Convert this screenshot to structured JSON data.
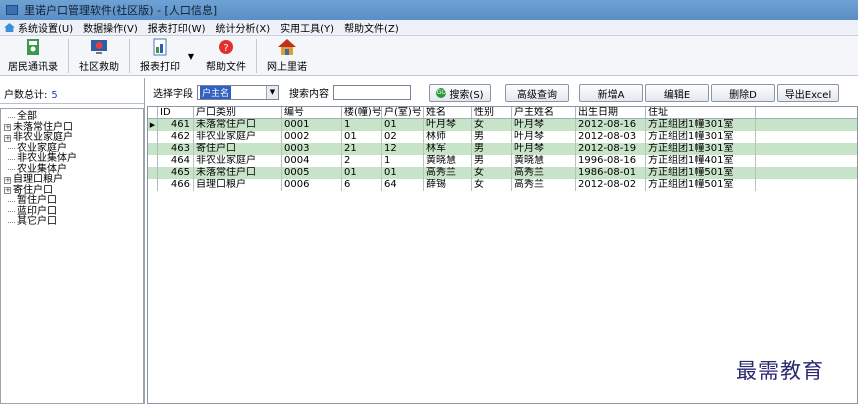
{
  "window": {
    "title": "里诺户口管理软件(社区版) - [人口信息]"
  },
  "menu": [
    "系统设置(U)",
    "数据操作(V)",
    "报表打印(W)",
    "统计分析(X)",
    "实用工具(Y)",
    "帮助文件(Z)"
  ],
  "toolbar": {
    "resident": "居民通讯录",
    "relief": "社区救助",
    "report": "报表打印",
    "help": "帮助文件",
    "online": "网上里诺"
  },
  "left": {
    "count_label": "户数总计:",
    "count_value": "5",
    "tree": [
      {
        "label": "全部",
        "type": "leaf"
      },
      {
        "label": "未落常住户口",
        "type": "plus"
      },
      {
        "label": "非农业家庭户",
        "type": "plus"
      },
      {
        "label": "农业家庭户",
        "type": "leaf"
      },
      {
        "label": "非农业集体户",
        "type": "leaf"
      },
      {
        "label": "农业集体户",
        "type": "leaf"
      },
      {
        "label": "自理口粮户",
        "type": "plus"
      },
      {
        "label": "寄住户口",
        "type": "plus"
      },
      {
        "label": "暂住户口",
        "type": "leaf"
      },
      {
        "label": "蓝印户口",
        "type": "leaf"
      },
      {
        "label": "其它户口",
        "type": "leaf"
      }
    ]
  },
  "filter": {
    "field_label": "选择字段",
    "field_value": "户主名",
    "content_label": "搜索内容",
    "content_value": "",
    "search": "搜索(S)",
    "advanced": "高级查询",
    "add": "新增A",
    "edit": "编辑E",
    "delete": "删除D",
    "export": "导出Excel"
  },
  "table": {
    "columns": [
      "ID",
      "户口类别",
      "编号",
      "楼(幢)号",
      "户(室)号",
      "姓名",
      "性别",
      "户主姓名",
      "出生日期",
      "住址"
    ],
    "rows": [
      [
        "461",
        "未落常住户口",
        "0001",
        "1",
        "01",
        "叶月琴",
        "女",
        "叶月琴",
        "2012-08-16",
        "方正组团1幢301室"
      ],
      [
        "462",
        "非农业家庭户",
        "0002",
        "01",
        "02",
        "林师",
        "男",
        "叶月琴",
        "2012-08-03",
        "方正组团1幢301室"
      ],
      [
        "463",
        "寄住户口",
        "0003",
        "21",
        "12",
        "林军",
        "男",
        "叶月琴",
        "2012-08-19",
        "方正组团1幢301室"
      ],
      [
        "464",
        "非农业家庭户",
        "0004",
        "2",
        "1",
        "黄晓慧",
        "男",
        "黄晓慧",
        "1996-08-16",
        "方正组团1幢401室"
      ],
      [
        "465",
        "未落常住户口",
        "0005",
        "01",
        "01",
        "高秀兰",
        "女",
        "高秀兰",
        "1986-08-01",
        "方正组团1幢501室"
      ],
      [
        "466",
        "自理口粮户",
        "0006",
        "6",
        "64",
        "薛锡",
        "女",
        "高秀兰",
        "2012-08-02",
        "方正组团1幢501室"
      ]
    ]
  },
  "watermark": "最需教育"
}
